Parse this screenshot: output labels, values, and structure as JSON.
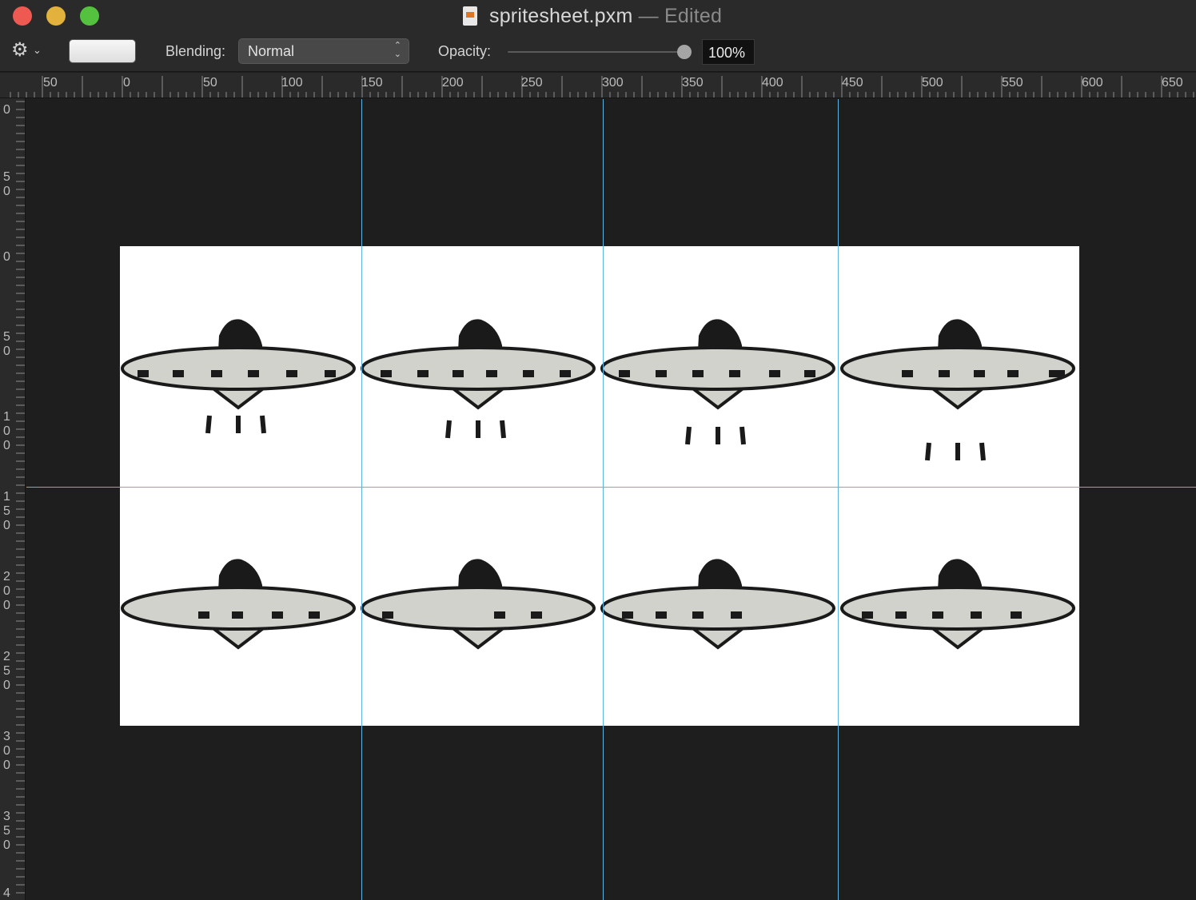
{
  "window": {
    "file_name": "spritesheet.pxm",
    "separator": "—",
    "status": "Edited"
  },
  "toolbar": {
    "gear_icon": "gear-icon",
    "blending_label": "Blending:",
    "blending_value": "Normal",
    "opacity_label": "Opacity:",
    "opacity_value": "100%",
    "opacity_level": 1.0
  },
  "rulers": {
    "horizontal": [
      "50",
      "0",
      "50",
      "100",
      "150",
      "200",
      "250",
      "300",
      "350",
      "400",
      "450",
      "500",
      "550",
      "600",
      "650"
    ],
    "vertical": [
      "0",
      "50",
      "0",
      "50",
      "100",
      "150",
      "200",
      "250",
      "300",
      "350",
      "4"
    ]
  },
  "sprites": {
    "rows": 2,
    "columns": 4,
    "first_row_has_thrusters": true,
    "second_row_has_thrusters": false
  }
}
